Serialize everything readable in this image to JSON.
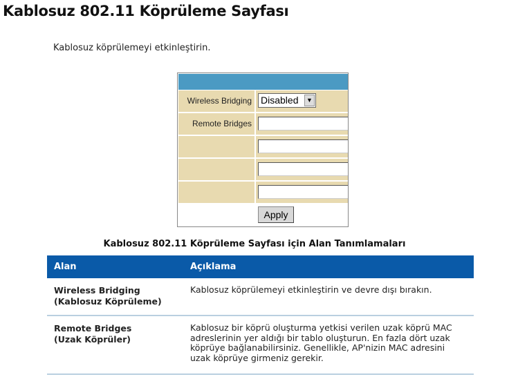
{
  "page": {
    "title": "Kablosuz 802.11 Köprüleme Sayfası",
    "intro": "Kablosuz köprülemeyi etkinleştirin."
  },
  "form": {
    "wireless_bridging_label": "Wireless Bridging",
    "wireless_bridging_value": "Disabled",
    "remote_bridges_label": "Remote Bridges",
    "remote_bridges": [
      "",
      "",
      "",
      ""
    ],
    "apply_label": "Apply",
    "colors": {
      "header": "#4b9ac3",
      "row": "#e8dab0"
    }
  },
  "table": {
    "caption": "Kablosuz 802.11 Köprüleme Sayfası için Alan Tanımlamaları",
    "headers": [
      "Alan",
      "Açıklama"
    ],
    "header_color": "#0a5aa8",
    "rows": [
      {
        "field": "Wireless Bridging",
        "field_tr": "(Kablosuz Köprüleme)",
        "desc": "Kablosuz köprülemeyi etkinleştirin ve devre dışı bırakın."
      },
      {
        "field": "Remote Bridges",
        "field_tr": "(Uzak Köprüler)",
        "desc": "Kablosuz bir köprü oluşturma yetkisi verilen uzak köprü MAC adreslerinin yer aldığı bir tablo oluşturun. En fazla dört uzak köprüye bağlanabilirsiniz. Genellikle, AP'nizin MAC adresini uzak köprüye girmeniz gerekir."
      }
    ]
  }
}
